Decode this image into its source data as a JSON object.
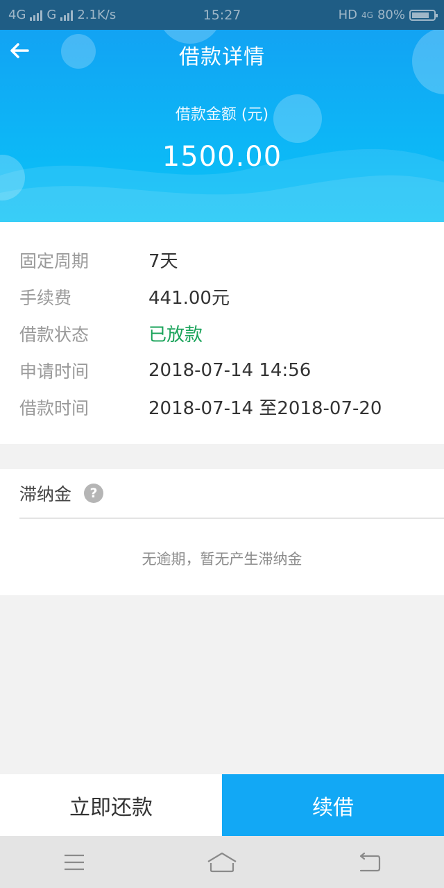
{
  "status_bar": {
    "network1": "4G",
    "network2": "G",
    "speed": "2.1K/s",
    "time": "15:27",
    "hd": "HD",
    "network3": "4G",
    "battery": "80%",
    "battery_level": 0.8
  },
  "header": {
    "title": "借款详情",
    "amount_label": "借款金额 (元)",
    "amount_value": "1500.00",
    "back_icon": "arrow-left-icon"
  },
  "details": {
    "rows": [
      {
        "key": "固定周期",
        "value": "7天"
      },
      {
        "key": "手续费",
        "value": "441.00元"
      },
      {
        "key": "借款状态",
        "value": "已放款"
      },
      {
        "key": "申请时间",
        "value": "2018-07-14 14:56"
      },
      {
        "key": "借款时间",
        "value": "2018-07-14 至2018-07-20"
      }
    ]
  },
  "late_fee": {
    "title": "滞纳金",
    "help_glyph": "?",
    "message": "无逾期，暂无产生滞纳金"
  },
  "actions": {
    "repay_label": "立即还款",
    "renew_label": "续借"
  },
  "colors": {
    "accent": "#12a8f5",
    "status_ok": "#1aa35a"
  },
  "system_nav": {
    "icons": [
      "menu-icon",
      "home-icon",
      "back-icon"
    ]
  }
}
